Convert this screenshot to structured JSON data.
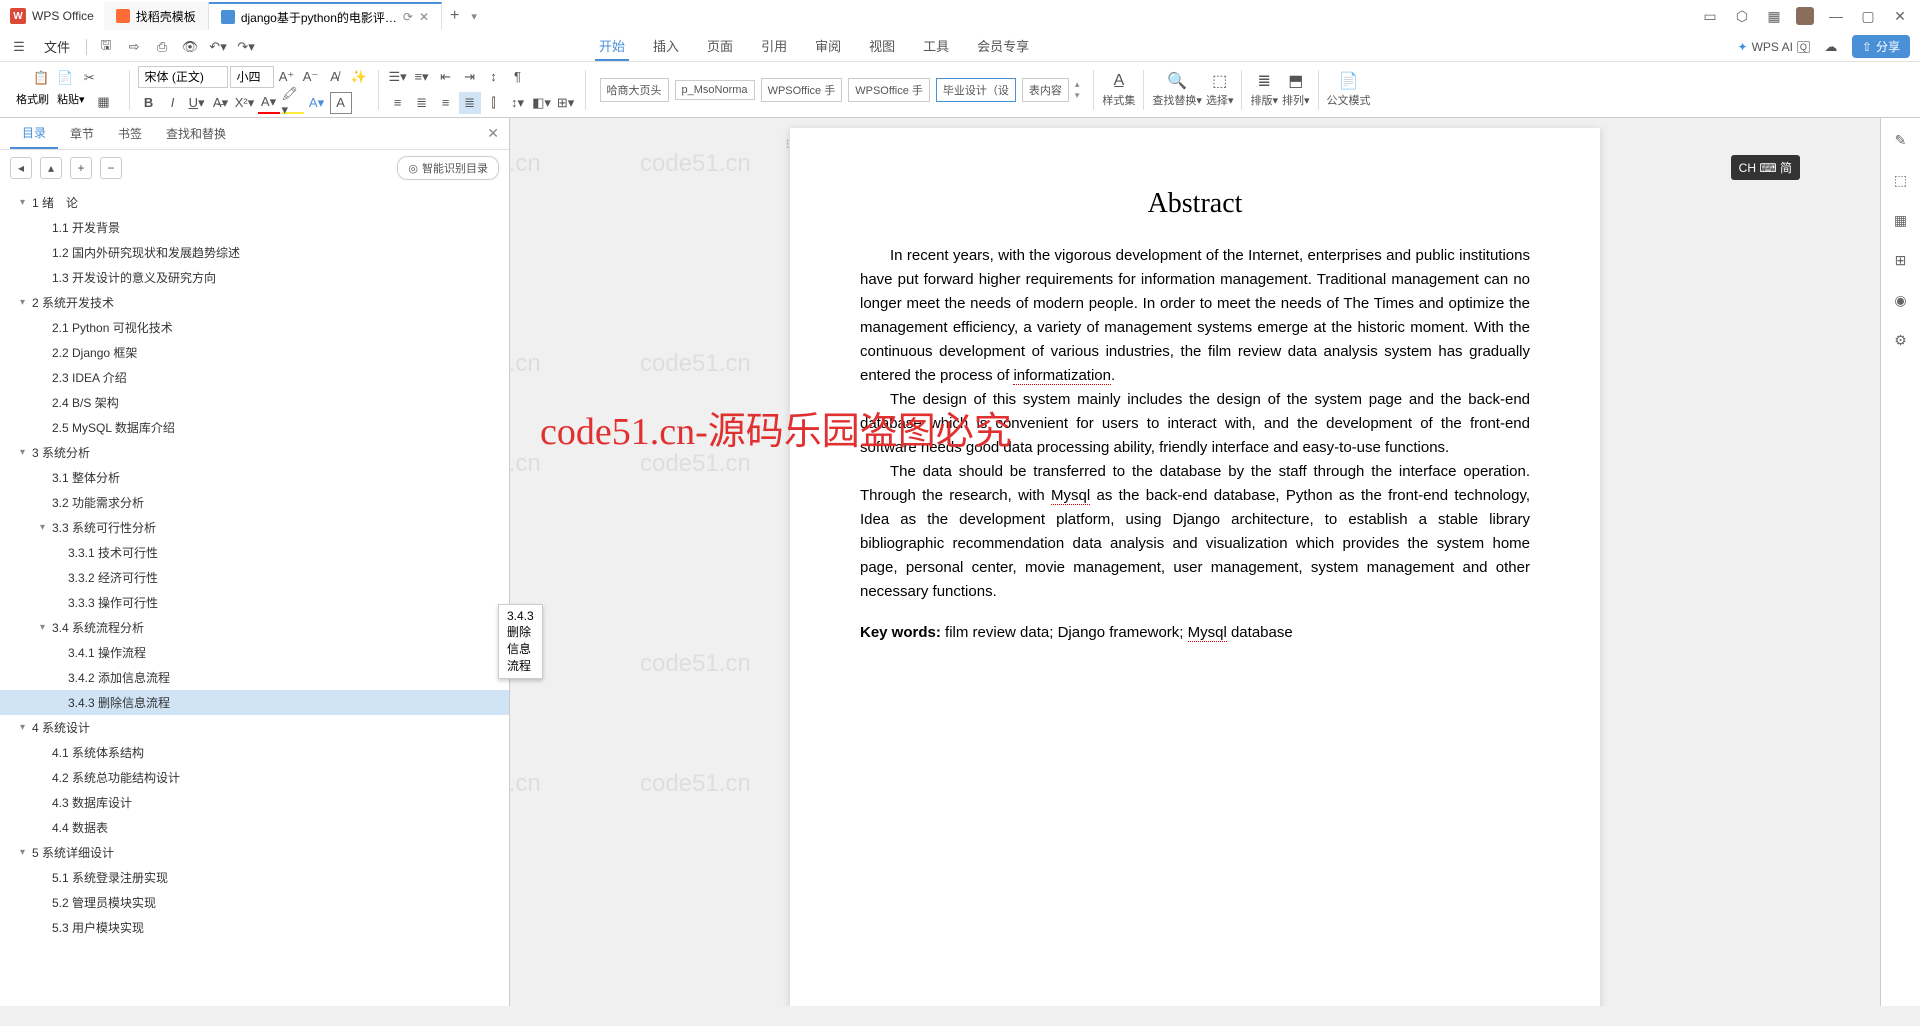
{
  "app": {
    "name": "WPS Office",
    "tabs": [
      {
        "label": "找稻壳模板",
        "icon": "orange"
      },
      {
        "label": "django基于python的电影评…",
        "icon": "blue",
        "active": true
      }
    ]
  },
  "title_icons": [
    "▭",
    "⬡",
    "◫",
    "⬚",
    "—",
    "▢",
    "✕"
  ],
  "menu": {
    "file": "文件",
    "tabs": [
      "开始",
      "插入",
      "页面",
      "引用",
      "审阅",
      "视图",
      "工具",
      "会员专享"
    ],
    "active": "开始",
    "wps_ai": "WPS AI",
    "share": "分享"
  },
  "ribbon": {
    "format_painter": "格式刷",
    "paste": "粘贴",
    "font_name": "宋体 (正文)",
    "font_size": "小四",
    "styles": [
      "哈商大页头",
      "p_MsoNorma",
      "WPSOffice 手",
      "WPSOffice 手",
      "毕业设计（设",
      "表内容"
    ],
    "style_selected": 4,
    "style_collection": "样式集",
    "find_replace": "查找替换",
    "select": "选择",
    "layout": "排版",
    "arrange": "排列",
    "doc_mode": "公文模式"
  },
  "sidebar": {
    "tabs": [
      "目录",
      "章节",
      "书签",
      "查找和替换"
    ],
    "active": "目录",
    "auto_outline": "智能识别目录",
    "tooltip": "3.4.3删除信息流程",
    "outline": [
      {
        "level": 0,
        "text": "1 绪　论",
        "caret": true
      },
      {
        "level": 1,
        "text": "1.1 开发背景"
      },
      {
        "level": 1,
        "text": "1.2 国内外研究现状和发展趋势综述"
      },
      {
        "level": 1,
        "text": "1.3 开发设计的意义及研究方向"
      },
      {
        "level": 0,
        "text": "2 系统开发技术",
        "caret": true
      },
      {
        "level": 1,
        "text": "2.1 Python 可视化技术"
      },
      {
        "level": 1,
        "text": "2.2 Django 框架"
      },
      {
        "level": 1,
        "text": "2.3 IDEA 介绍"
      },
      {
        "level": 1,
        "text": "2.4 B/S 架构"
      },
      {
        "level": 1,
        "text": "2.5 MySQL 数据库介绍"
      },
      {
        "level": 0,
        "text": "3 系统分析",
        "caret": true
      },
      {
        "level": 1,
        "text": "3.1 整体分析"
      },
      {
        "level": 1,
        "text": "3.2 功能需求分析"
      },
      {
        "level": 1,
        "text": "3.3 系统可行性分析",
        "caret": true
      },
      {
        "level": 2,
        "text": "3.3.1 技术可行性"
      },
      {
        "level": 2,
        "text": "3.3.2 经济可行性"
      },
      {
        "level": 2,
        "text": "3.3.3 操作可行性"
      },
      {
        "level": 1,
        "text": "3.4 系统流程分析",
        "caret": true
      },
      {
        "level": 2,
        "text": "3.4.1 操作流程"
      },
      {
        "level": 2,
        "text": "3.4.2 添加信息流程"
      },
      {
        "level": 2,
        "text": "3.4.3 删除信息流程",
        "selected": true
      },
      {
        "level": 0,
        "text": "4 系统设计",
        "caret": true
      },
      {
        "level": 1,
        "text": "4.1 系统体系结构"
      },
      {
        "level": 1,
        "text": "4.2 系统总功能结构设计"
      },
      {
        "level": 1,
        "text": "4.3 数据库设计"
      },
      {
        "level": 1,
        "text": "4.4 数据表"
      },
      {
        "level": 0,
        "text": "5 系统详细设计",
        "caret": true
      },
      {
        "level": 1,
        "text": "5.1 系统登录注册实现"
      },
      {
        "level": 1,
        "text": "5.2 管理员模块实现"
      },
      {
        "level": 1,
        "text": "5.3 用户模块实现"
      }
    ]
  },
  "document": {
    "title": "Abstract",
    "para1": "In recent years, with the vigorous development of the Internet, enterprises and public institutions have put forward higher requirements for information management. Traditional management can no longer meet the needs of modern people. In order to meet the needs of The Times and optimize the management efficiency, a variety of management systems emerge at the historic moment. With the continuous development of various industries, the film review data analysis system has gradually entered the process of ",
    "para1_u": "informatization",
    "para1_end": ".",
    "para2": "The design of this system mainly includes the design of the system page and the back-end database which is convenient for users to interact with, and the development of the front-end software needs good data processing ability, friendly interface and easy-to-use functions.",
    "para3a": "The data should be transferred to the database by the staff through the interface operation. Through the research, with ",
    "para3_u1": "Mysql",
    "para3b": " as the back-end database, Python as the front-end technology, Idea as the development platform, using Django architecture, to establish a stable library bibliographic recommendation data analysis and visualization which provides the system home page, personal center, movie management, user management, system management and other necessary functions.",
    "keywords_label": "Key words:",
    "keywords_a": " film review data; Django framework; ",
    "keywords_u": "Mysql",
    "keywords_b": " database"
  },
  "ime": "CH ⌨ 简",
  "watermark_text": "code51.cn",
  "watermark_red": "code51.cn-源码乐园盗图必究"
}
